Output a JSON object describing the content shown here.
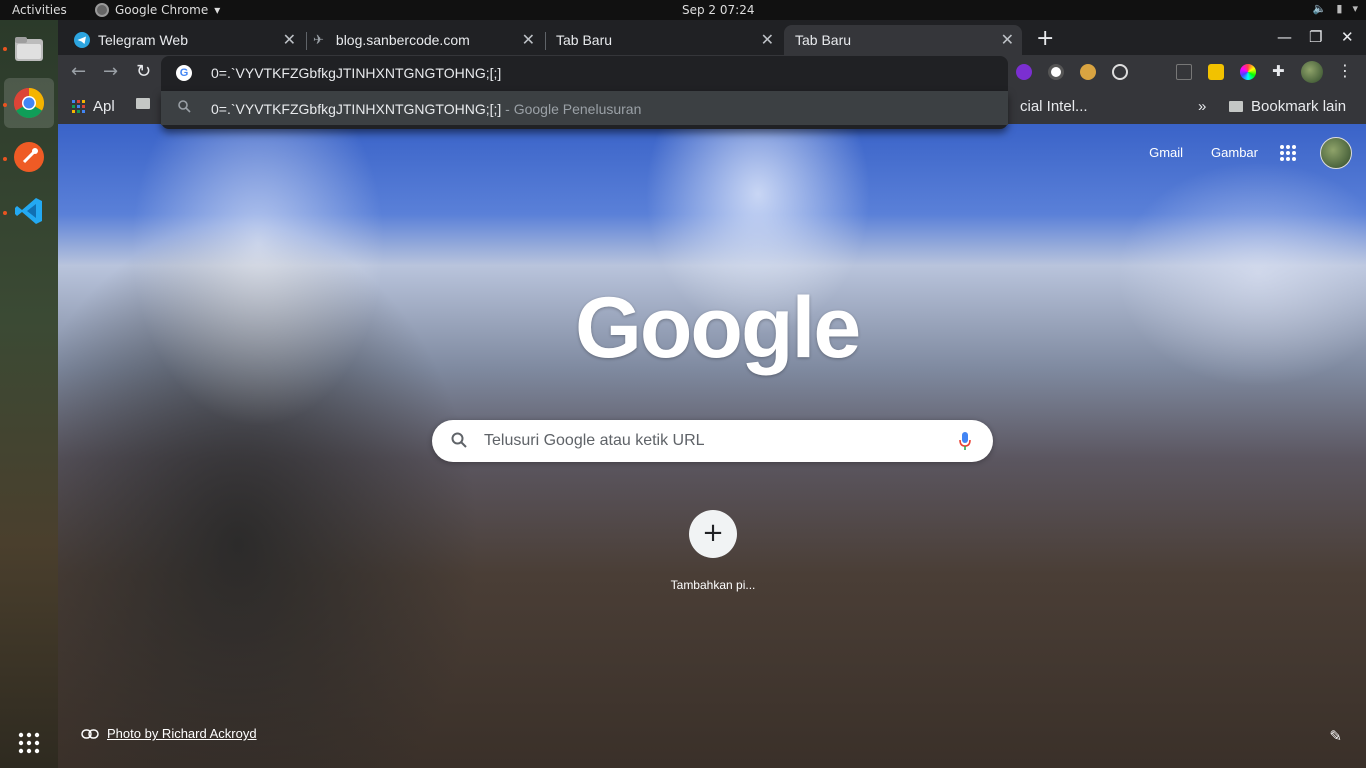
{
  "system": {
    "activities": "Activities",
    "app_name": "Google Chrome",
    "clock": "Sep 2  07:24"
  },
  "tabs": [
    {
      "title": "Telegram Web",
      "icon": "telegram-icon"
    },
    {
      "title": "blog.sanbercode.com",
      "icon": "sanbercode-icon"
    },
    {
      "title": "Tab Baru",
      "icon": ""
    },
    {
      "title": "Tab Baru",
      "icon": "",
      "active": true
    }
  ],
  "omnibox": {
    "value": "0=.`VYVTKFZGbfkgJTINHXNTGNGTOHNG;[;]"
  },
  "suggestion": {
    "query": "0=.`VYVTKFZGbfkgJTINHXNTGNGTOHNG;[;]",
    "suffix": " - Google Penelusuran"
  },
  "bookmarks": {
    "apps": "Apl",
    "partial": "cial Intel...",
    "other": "Bookmark lain"
  },
  "ntp": {
    "gmail": "Gmail",
    "images": "Gambar",
    "logo": "Google",
    "search_placeholder": "Telusuri Google atau ketik URL",
    "add_shortcut_label": "Tambahkan pi...",
    "photo_credit": "Photo by Richard Ackroyd"
  }
}
